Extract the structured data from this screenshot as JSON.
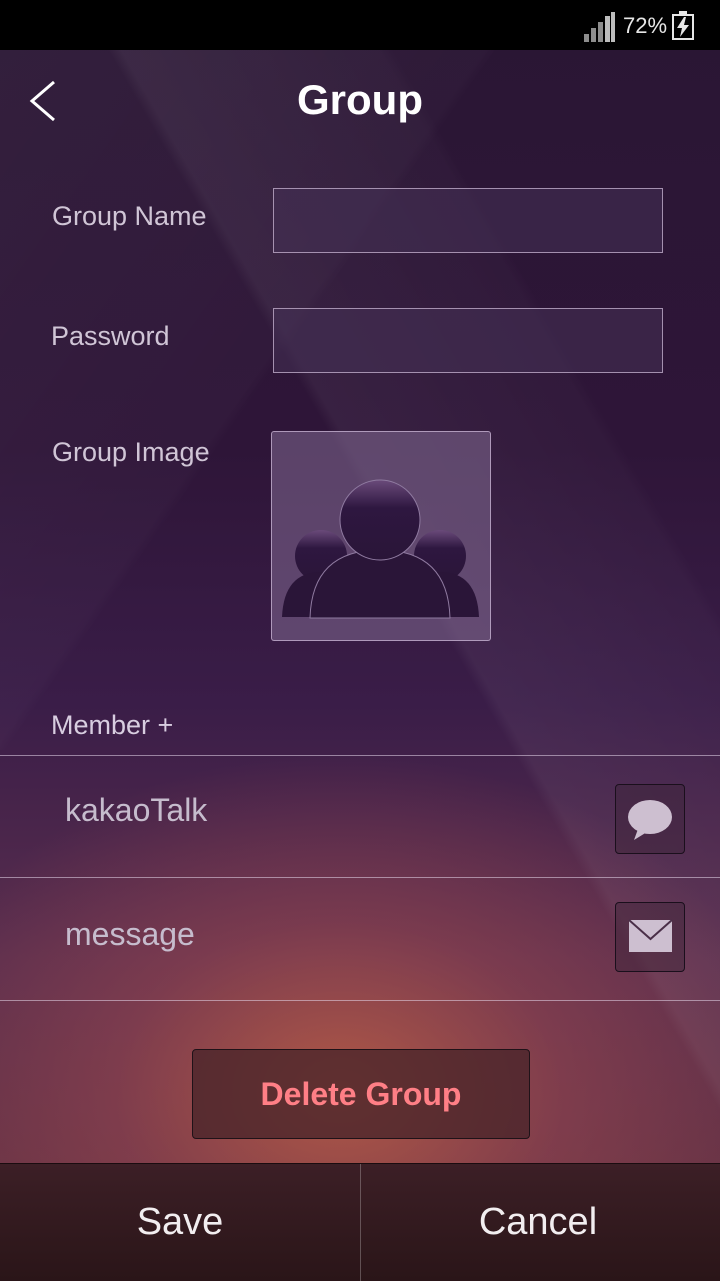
{
  "status_bar": {
    "battery_percent": "72%"
  },
  "header": {
    "title": "Group"
  },
  "form": {
    "group_name_label": "Group Name",
    "group_name_value": "",
    "password_label": "Password",
    "password_value": "",
    "group_image_label": "Group Image"
  },
  "member": {
    "label": "Member +",
    "rows": [
      {
        "label": "kakaoTalk",
        "icon": "chat-bubble-icon"
      },
      {
        "label": "message",
        "icon": "envelope-icon"
      }
    ]
  },
  "actions": {
    "delete_label": "Delete Group",
    "save_label": "Save",
    "cancel_label": "Cancel"
  },
  "colors": {
    "delete_text": "#ff7f86",
    "title": "#ffffff",
    "label": "#d0c5d6"
  }
}
